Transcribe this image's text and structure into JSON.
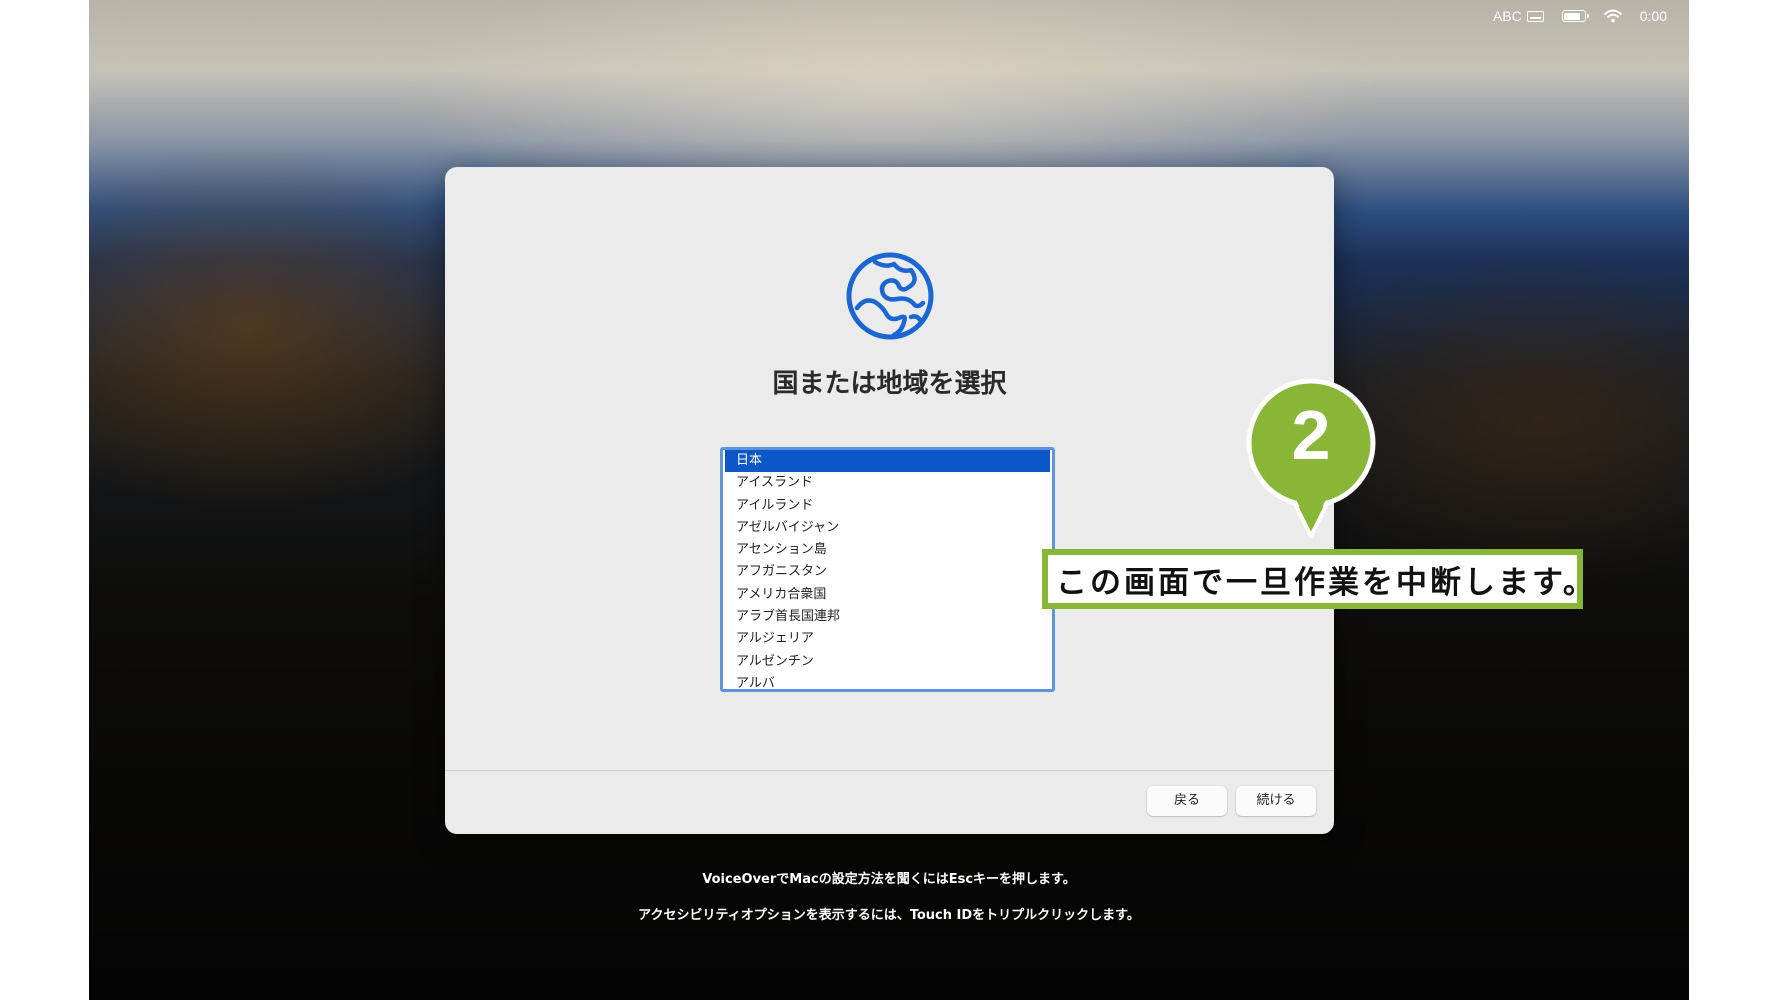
{
  "status_bar": {
    "input_source": "ABC",
    "time": "0:00"
  },
  "dialog": {
    "title": "国または地域を選択",
    "countries": [
      "日本",
      "アイスランド",
      "アイルランド",
      "アゼルバイジャン",
      "アセンション島",
      "アフガニスタン",
      "アメリカ合衆国",
      "アラブ首長国連邦",
      "アルジェリア",
      "アルゼンチン",
      "アルバ"
    ],
    "selected_index": 0,
    "back_label": "戻る",
    "continue_label": "続ける"
  },
  "footer": {
    "voiceover_hint": "VoiceOverでMacの設定方法を聞くにはEscキーを押します。",
    "accessibility_hint": "アクセシビリティオプションを表示するには、Touch IDをトリプルクリックします。"
  },
  "annotation": {
    "step_number": "2",
    "message": "この画面で一旦作業を中断します。"
  },
  "colors": {
    "accent": "#0b57c8",
    "globe": "#1a66d2",
    "callout_green": "#8ab638"
  }
}
